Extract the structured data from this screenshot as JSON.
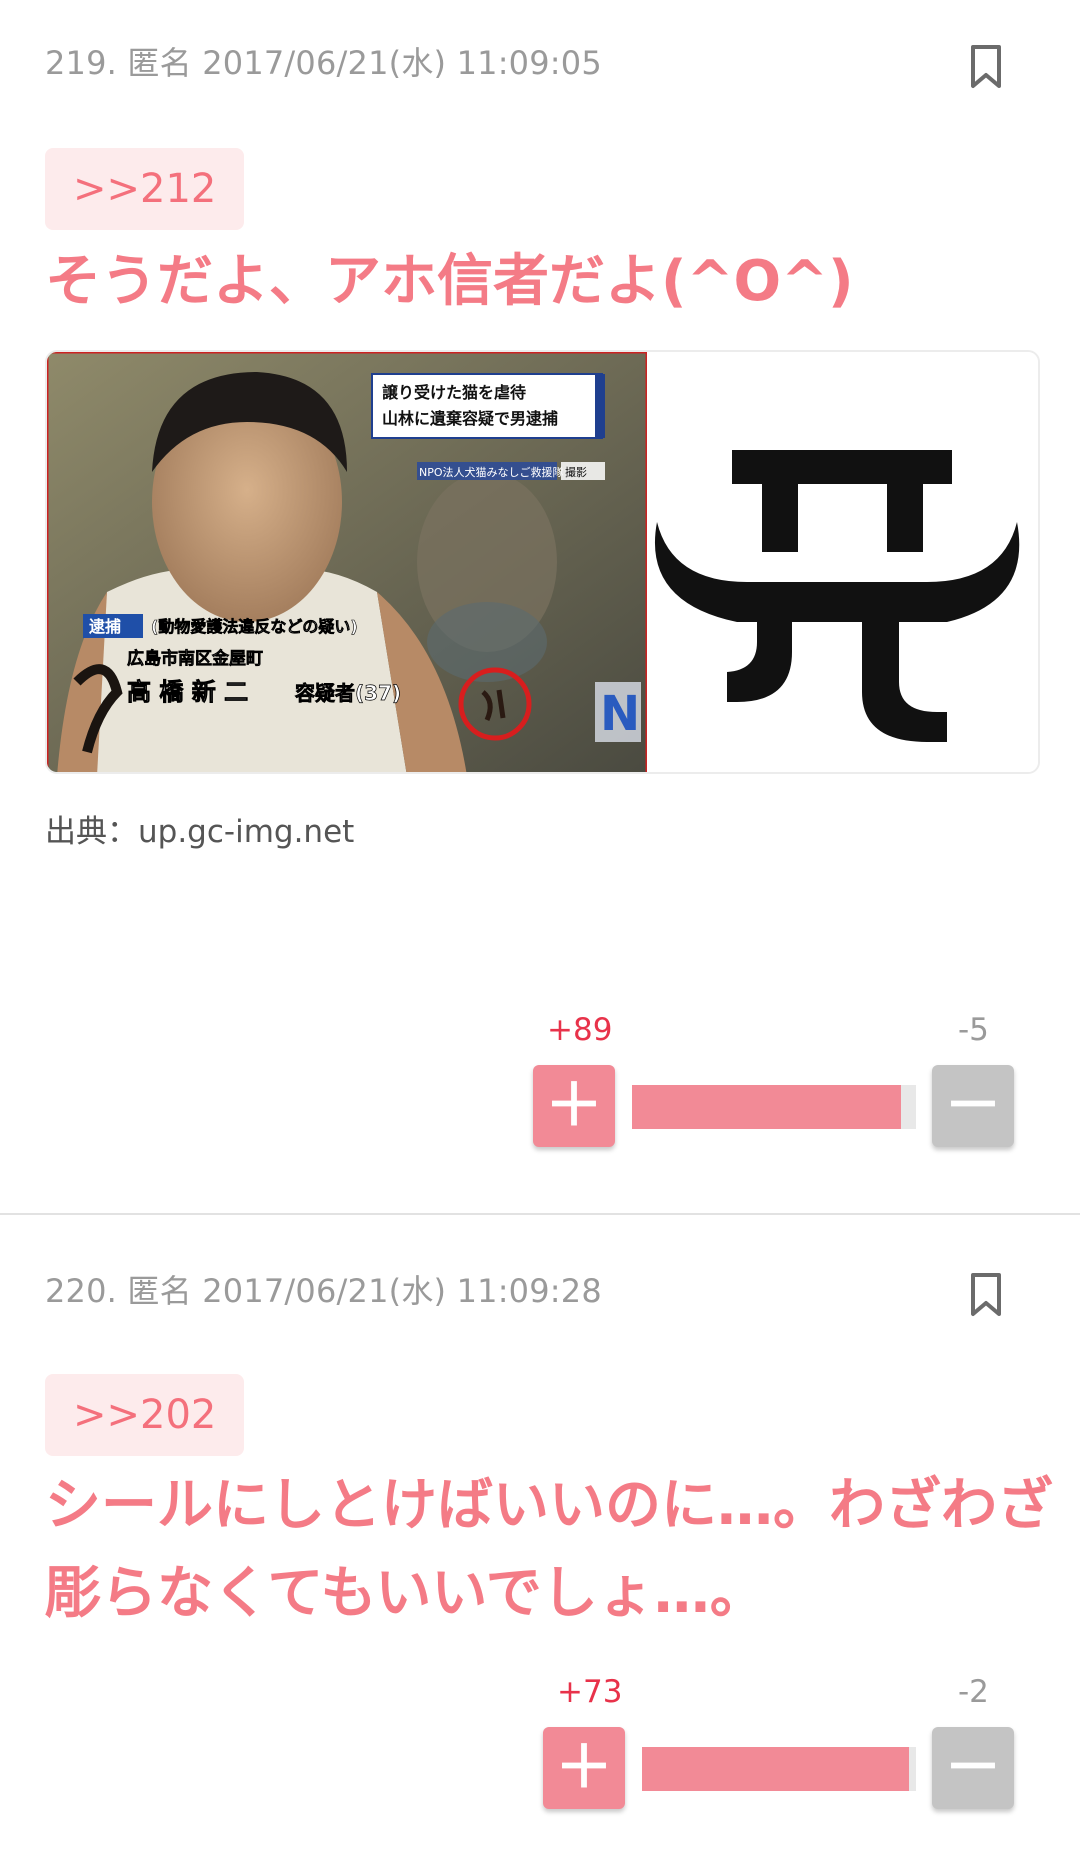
{
  "comments": [
    {
      "meta": "219. 匿名 2017/06/21(水) 11:09:05",
      "anchor": ">>212",
      "text": "そうだよ、アホ信者だよ(^O^)",
      "image": {
        "caption_top_line1": "譲り受けた猫を虐待",
        "caption_top_line2": "山林に遺棄容疑で男逮捕",
        "npo_label": "NPO法人犬猫みなしご救援隊",
        "shot_label": "撮影",
        "arrest_badge": "逮捕",
        "charge": "(動物愛護法違反などの疑い)",
        "address": "広島市南区金屋町",
        "name": "高 橋 新 二",
        "suspect": "容疑者(37)",
        "channel": "N"
      },
      "source_label": "出典：",
      "source_url": "up.gc-img.net",
      "plus": "+89",
      "minus": "-5",
      "ratio": 0.947,
      "plus_icon": "＋",
      "minus_icon": "－"
    },
    {
      "meta": "220. 匿名 2017/06/21(水) 11:09:28",
      "anchor": ">>202",
      "text": "シールにしとけばいいのに…。わざわざ彫らなくてもいいでしょ…。",
      "plus": "+73",
      "minus": "-2",
      "ratio": 0.973,
      "plus_icon": "＋",
      "minus_icon": "－"
    }
  ],
  "colors": {
    "accent_pink": "#f47b86",
    "vote_plus": "#f28a96",
    "vote_minus": "#c4c4c4",
    "plus_count": "#e8324a"
  },
  "icons": {
    "bookmark": "bookmark-icon",
    "plus": "plus-icon",
    "minus": "minus-icon"
  }
}
